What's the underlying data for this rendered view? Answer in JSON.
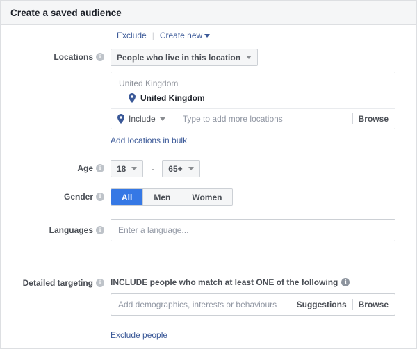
{
  "dialog": {
    "title": "Create a saved audience"
  },
  "custom_audience_links": {
    "exclude_label": "Exclude",
    "create_new_label": "Create new",
    "caret_icon": "caret-down-icon"
  },
  "locations": {
    "label": "Locations",
    "info_icon": "info-icon",
    "type_select": {
      "value": "People who live in this location",
      "caret_icon": "caret-down-icon"
    },
    "group_label": "United Kingdom",
    "selected": [
      {
        "name": "United Kingdom",
        "pin_icon": "map-pin-icon"
      }
    ],
    "include_select": {
      "value": "Include",
      "pin_icon": "map-pin-icon",
      "caret_icon": "caret-down-icon"
    },
    "search_placeholder": "Type to add more locations",
    "search_value": "",
    "browse_label": "Browse",
    "bulk_link": "Add locations in bulk"
  },
  "age": {
    "label": "Age",
    "info_icon": "info-icon",
    "min": "18",
    "max": "65+",
    "separator": "-",
    "caret_icon": "caret-down-icon"
  },
  "gender": {
    "label": "Gender",
    "info_icon": "info-icon",
    "options": [
      "All",
      "Men",
      "Women"
    ],
    "selected": "All",
    "selected_color": "#3578e5"
  },
  "languages": {
    "label": "Languages",
    "info_icon": "info-icon",
    "placeholder": "Enter a language...",
    "value": ""
  },
  "detailed_targeting": {
    "label": "Detailed targeting",
    "info_icon": "info-icon",
    "heading": "INCLUDE people who match at least ONE of the following",
    "heading_info_icon": "info-icon",
    "placeholder": "Add demographics, interests or behaviours",
    "value": "",
    "suggestions_label": "Suggestions",
    "browse_label": "Browse",
    "exclude_link": "Exclude people"
  }
}
